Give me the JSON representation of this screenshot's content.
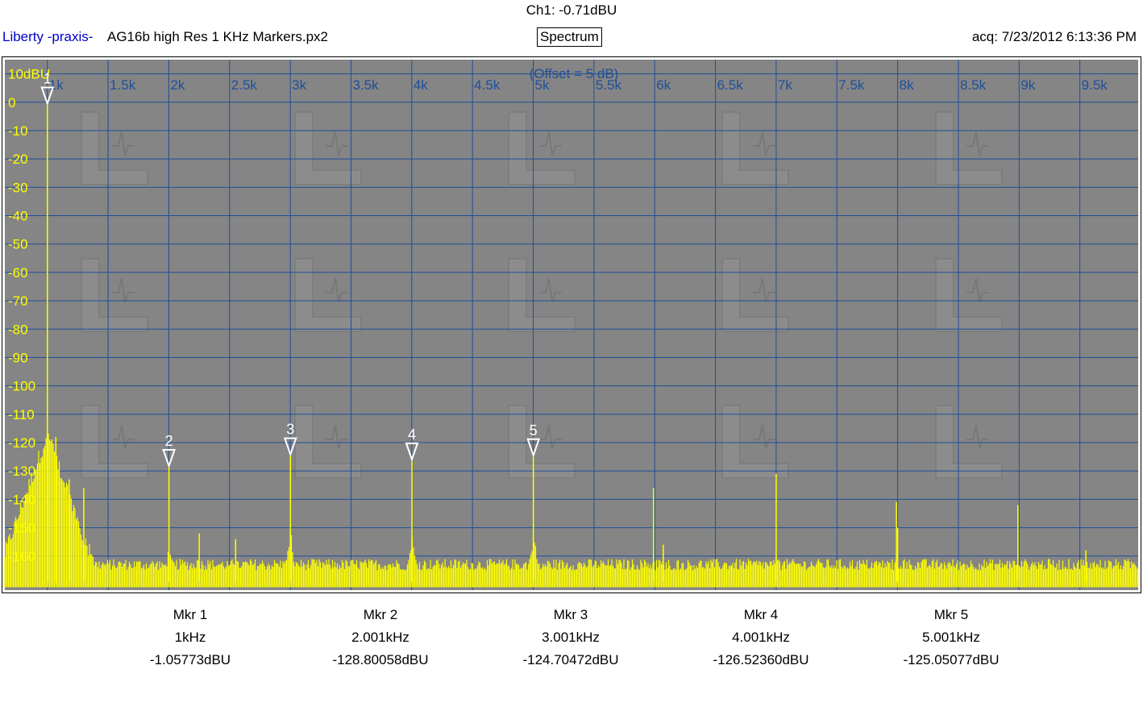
{
  "header": {
    "channel_readout": "Ch1: -0.71dBU",
    "brand": "Liberty -praxis-",
    "filename": "AG16b high Res 1 KHz Markers.px2",
    "mode": "Spectrum",
    "acquired": "acq: 7/23/2012 6:13:36 PM"
  },
  "colors": {
    "plot_bg": "#858585",
    "grid": "#1e4f99",
    "trace": "#ffff00",
    "marker": "#ffffff"
  },
  "chart_data": {
    "type": "line",
    "annotation": "(Offset = 5 dB)",
    "x_unit": "Hz",
    "xlim": [
      650,
      9980
    ],
    "ylim": [
      -172,
      15
    ],
    "grid": true,
    "x_ticks": [
      1000,
      1500,
      2000,
      2500,
      3000,
      3500,
      4000,
      4500,
      5000,
      5500,
      6000,
      6500,
      7000,
      7500,
      8000,
      8500,
      9000,
      9500
    ],
    "x_tick_labels": [
      "1k",
      "1.5k",
      "2k",
      "2.5k",
      "3k",
      "3.5k",
      "4k",
      "4.5k",
      "5k",
      "5.5k",
      "6k",
      "6.5k",
      "7k",
      "7.5k",
      "8k",
      "8.5k",
      "9k",
      "9.5k"
    ],
    "y_ticks": [
      10,
      0,
      -10,
      -20,
      -30,
      -40,
      -50,
      -60,
      -70,
      -80,
      -90,
      -100,
      -110,
      -120,
      -130,
      -140,
      -150,
      -160
    ],
    "y_tick_labels": [
      "10dBU",
      "0",
      "-10",
      "-20",
      "-30",
      "-40",
      "-50",
      "-60",
      "-70",
      "-80",
      "-90",
      "-100",
      "-110",
      "-120",
      "-130",
      "-140",
      "-150",
      "-160"
    ],
    "noise_floor": -165,
    "peaks": [
      {
        "x": 1000,
        "y": -1.06
      },
      {
        "x": 1070,
        "y": -118
      },
      {
        "x": 1180,
        "y": -133
      },
      {
        "x": 1300,
        "y": -136
      },
      {
        "x": 2001,
        "y": -128.8
      },
      {
        "x": 2250,
        "y": -152
      },
      {
        "x": 2550,
        "y": -154
      },
      {
        "x": 3001,
        "y": -124.7
      },
      {
        "x": 4001,
        "y": -126.5
      },
      {
        "x": 5001,
        "y": -125.1
      },
      {
        "x": 5990,
        "y": -136
      },
      {
        "x": 6070,
        "y": -156
      },
      {
        "x": 7000,
        "y": -131
      },
      {
        "x": 7990,
        "y": -141
      },
      {
        "x": 8000,
        "y": -150
      },
      {
        "x": 8990,
        "y": -142
      },
      {
        "x": 9550,
        "y": -158
      }
    ],
    "markers": [
      {
        "label": "1",
        "x": 1000,
        "y": -1.06
      },
      {
        "label": "2",
        "x": 2001,
        "y": -128.8
      },
      {
        "label": "3",
        "x": 3001,
        "y": -124.7
      },
      {
        "label": "4",
        "x": 4001,
        "y": -126.52
      },
      {
        "label": "5",
        "x": 5001,
        "y": -125.05
      }
    ]
  },
  "marker_table": [
    {
      "name": "Mkr 1",
      "freq": "1kHz",
      "level": "-1.05773dBU"
    },
    {
      "name": "Mkr 2",
      "freq": "2.001kHz",
      "level": "-128.80058dBU"
    },
    {
      "name": "Mkr 3",
      "freq": "3.001kHz",
      "level": "-124.70472dBU"
    },
    {
      "name": "Mkr 4",
      "freq": "4.001kHz",
      "level": "-126.52360dBU"
    },
    {
      "name": "Mkr 5",
      "freq": "5.001kHz",
      "level": "-125.05077dBU"
    }
  ]
}
